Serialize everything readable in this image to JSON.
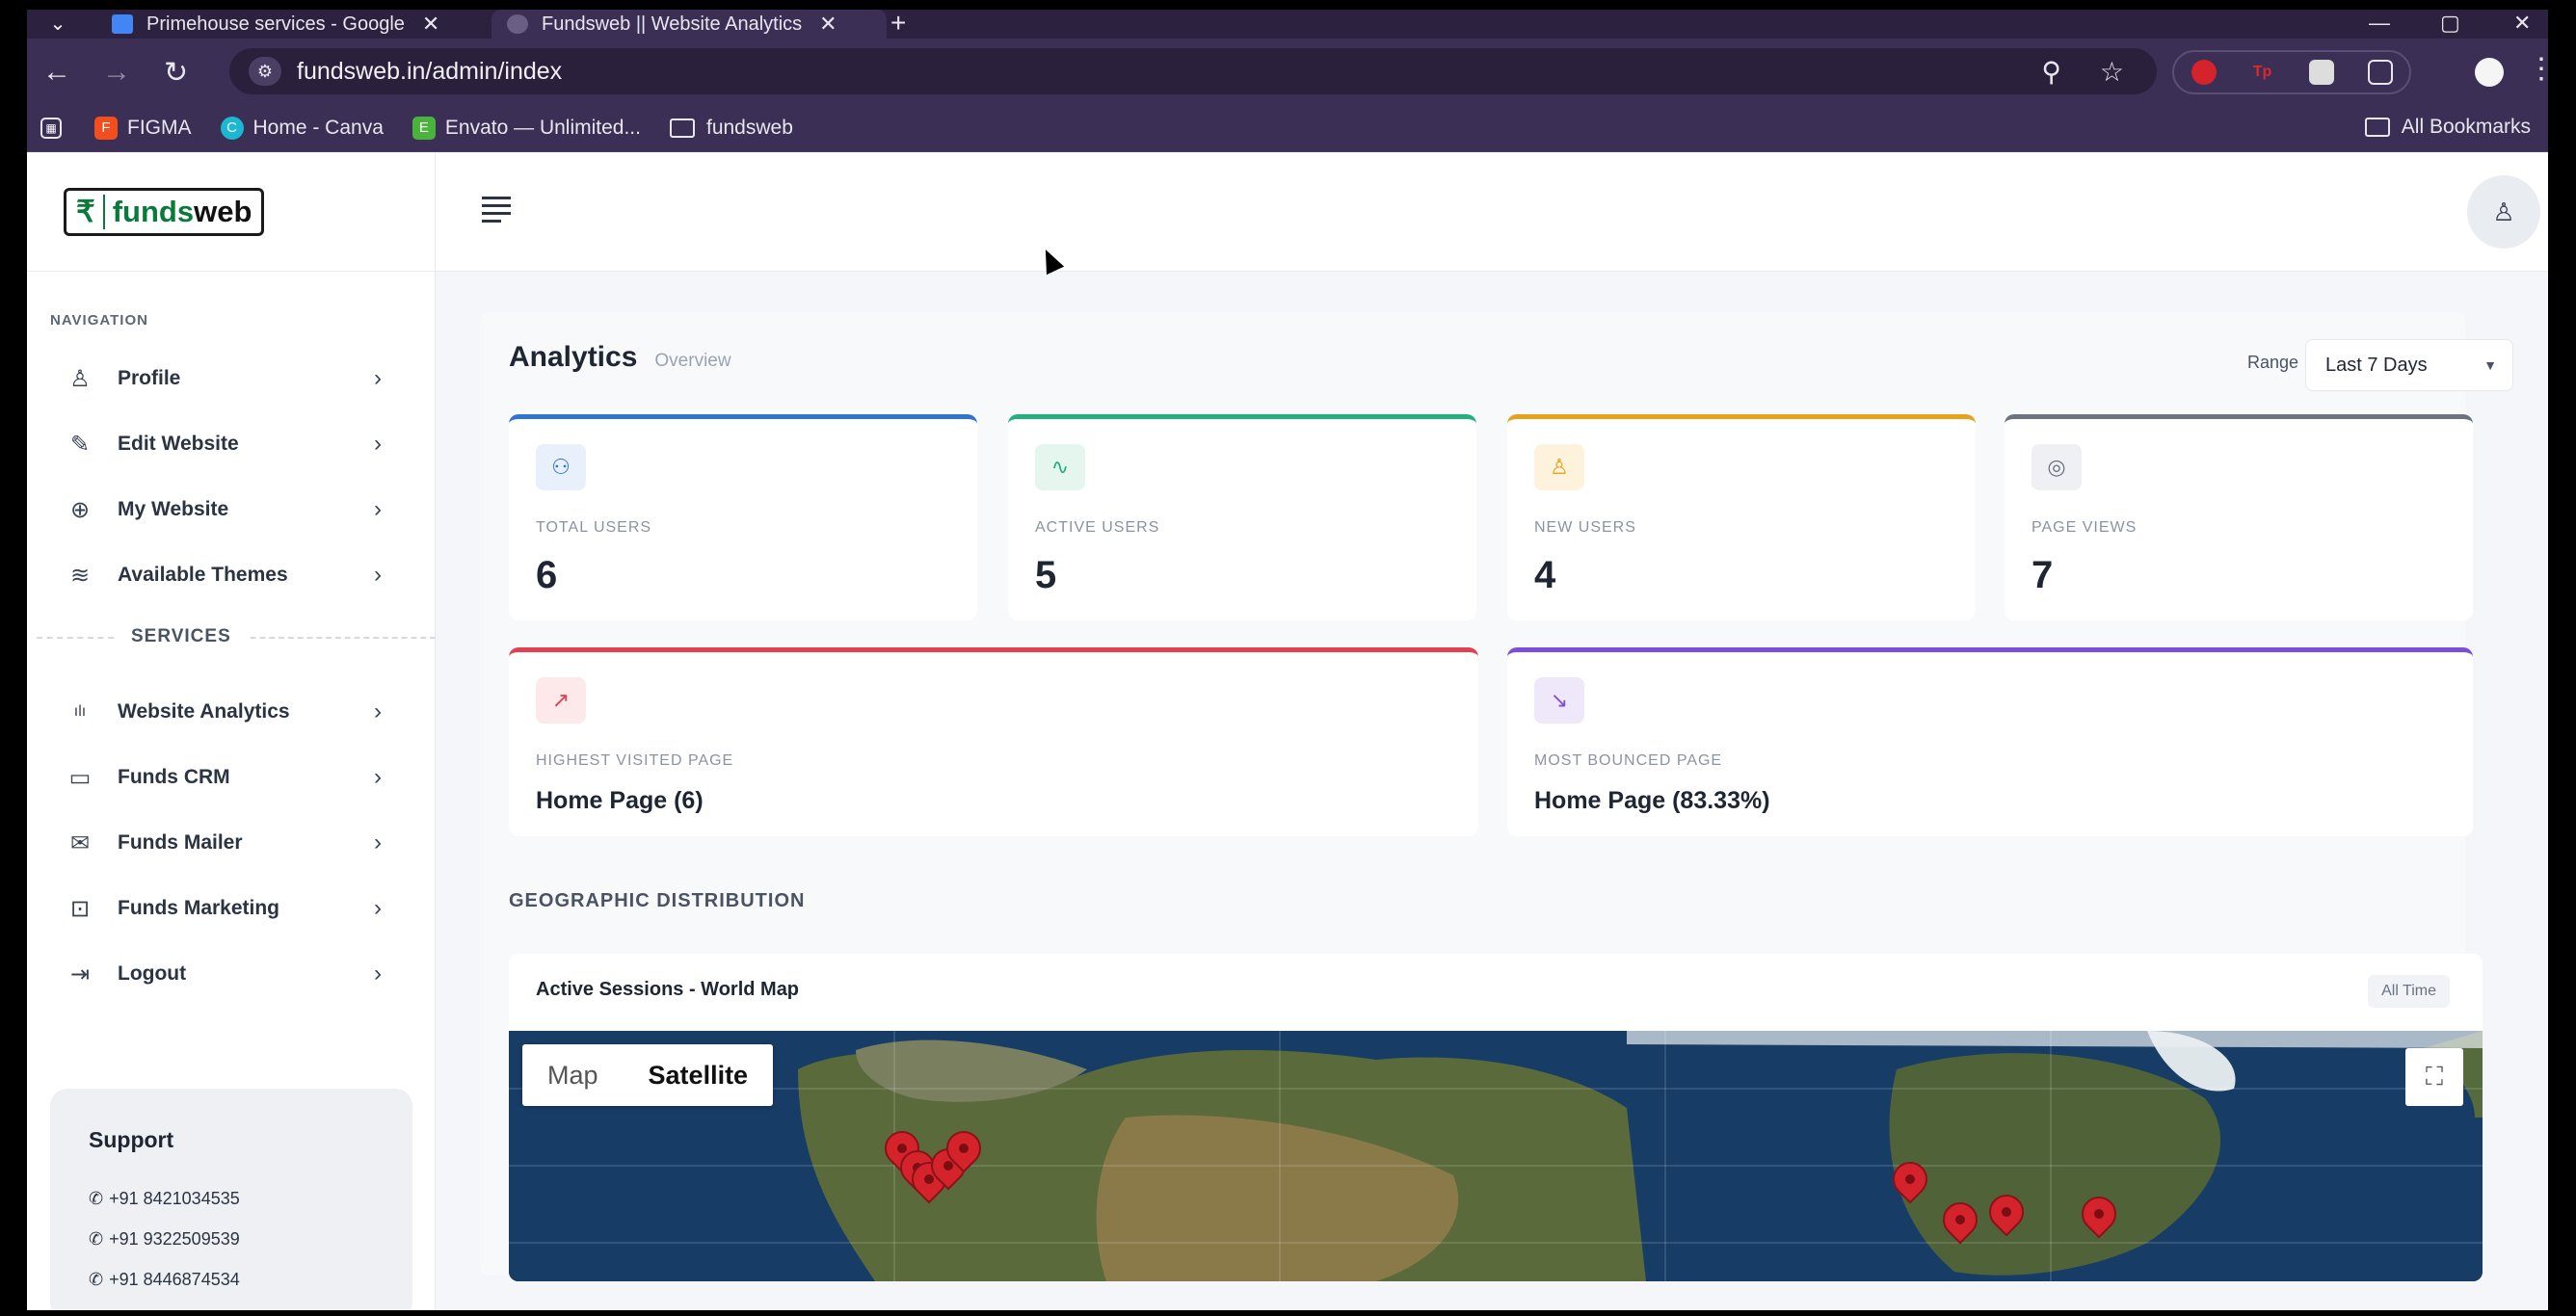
{
  "browser": {
    "tabs": [
      {
        "title": "Primehouse services - Google",
        "close": "✕"
      },
      {
        "title": "Fundsweb || Website Analytics",
        "close": "✕"
      }
    ],
    "new_tab": "+",
    "url": "fundsweb.in/admin/index",
    "bookmarks": [
      {
        "label": "FIGMA"
      },
      {
        "label": "Home - Canva"
      },
      {
        "label": "Envato — Unlimited..."
      },
      {
        "label": "fundsweb"
      }
    ],
    "all_bookmarks": "All Bookmarks",
    "extensions": [
      "",
      "Tp",
      "",
      ""
    ]
  },
  "sidebar": {
    "logo_mark": "₹",
    "logo_funds": "funds",
    "logo_web": "web",
    "nav_heading": "NAVIGATION",
    "nav_items": [
      {
        "label": "Profile",
        "icon": "user-icon",
        "glyph": "♙"
      },
      {
        "label": "Edit Website",
        "icon": "pencil-icon",
        "glyph": "✎"
      },
      {
        "label": "My Website",
        "icon": "globe-icon",
        "glyph": "⊕"
      },
      {
        "label": "Available Themes",
        "icon": "layers-icon",
        "glyph": "≋"
      }
    ],
    "services_heading": "SERVICES",
    "service_items": [
      {
        "label": "Website Analytics",
        "icon": "bar-chart-icon",
        "glyph": "ılı"
      },
      {
        "label": "Funds CRM",
        "icon": "monitor-icon",
        "glyph": "▭"
      },
      {
        "label": "Funds Mailer",
        "icon": "mail-icon",
        "glyph": "✉"
      },
      {
        "label": "Funds Marketing",
        "icon": "briefcase-icon",
        "glyph": "⊡"
      },
      {
        "label": "Logout",
        "icon": "logout-icon",
        "glyph": "⇥"
      }
    ],
    "support": {
      "title": "Support",
      "phones": [
        "+91 8421034535",
        "+91 9322509539",
        "+91 8446874534"
      ]
    }
  },
  "main": {
    "title": "Analytics",
    "subtitle": "Overview",
    "range_label": "Range",
    "range_value": "Last 7 Days",
    "stats": [
      {
        "label": "TOTAL USERS",
        "value": "6",
        "color": "#2f74d0",
        "icon": "users-icon",
        "glyph": "⚇"
      },
      {
        "label": "ACTIVE USERS",
        "value": "5",
        "color": "#22b07d",
        "icon": "activity-icon",
        "glyph": "∿"
      },
      {
        "label": "NEW USERS",
        "value": "4",
        "color": "#e6a21a",
        "icon": "user-plus-icon",
        "glyph": "♙"
      },
      {
        "label": "PAGE VIEWS",
        "value": "7",
        "color": "#6b7280",
        "icon": "eye-icon",
        "glyph": "◎"
      }
    ],
    "highest_visited": {
      "label": "HIGHEST VISITED PAGE",
      "value": "Home Page (6)",
      "color": "#e04050",
      "icon": "trending-up-icon",
      "glyph": "↗"
    },
    "most_bounced": {
      "label": "MOST BOUNCED PAGE",
      "value": "Home Page (83.33%)",
      "color": "#7c4ddb",
      "icon": "trending-down-icon",
      "glyph": "↘"
    },
    "geo_title": "GEOGRAPHIC DISTRIBUTION",
    "map_card": {
      "title": "Active Sessions - World Map",
      "badge": "All Time",
      "map_btn": "Map",
      "satellite_btn": "Satellite"
    }
  }
}
